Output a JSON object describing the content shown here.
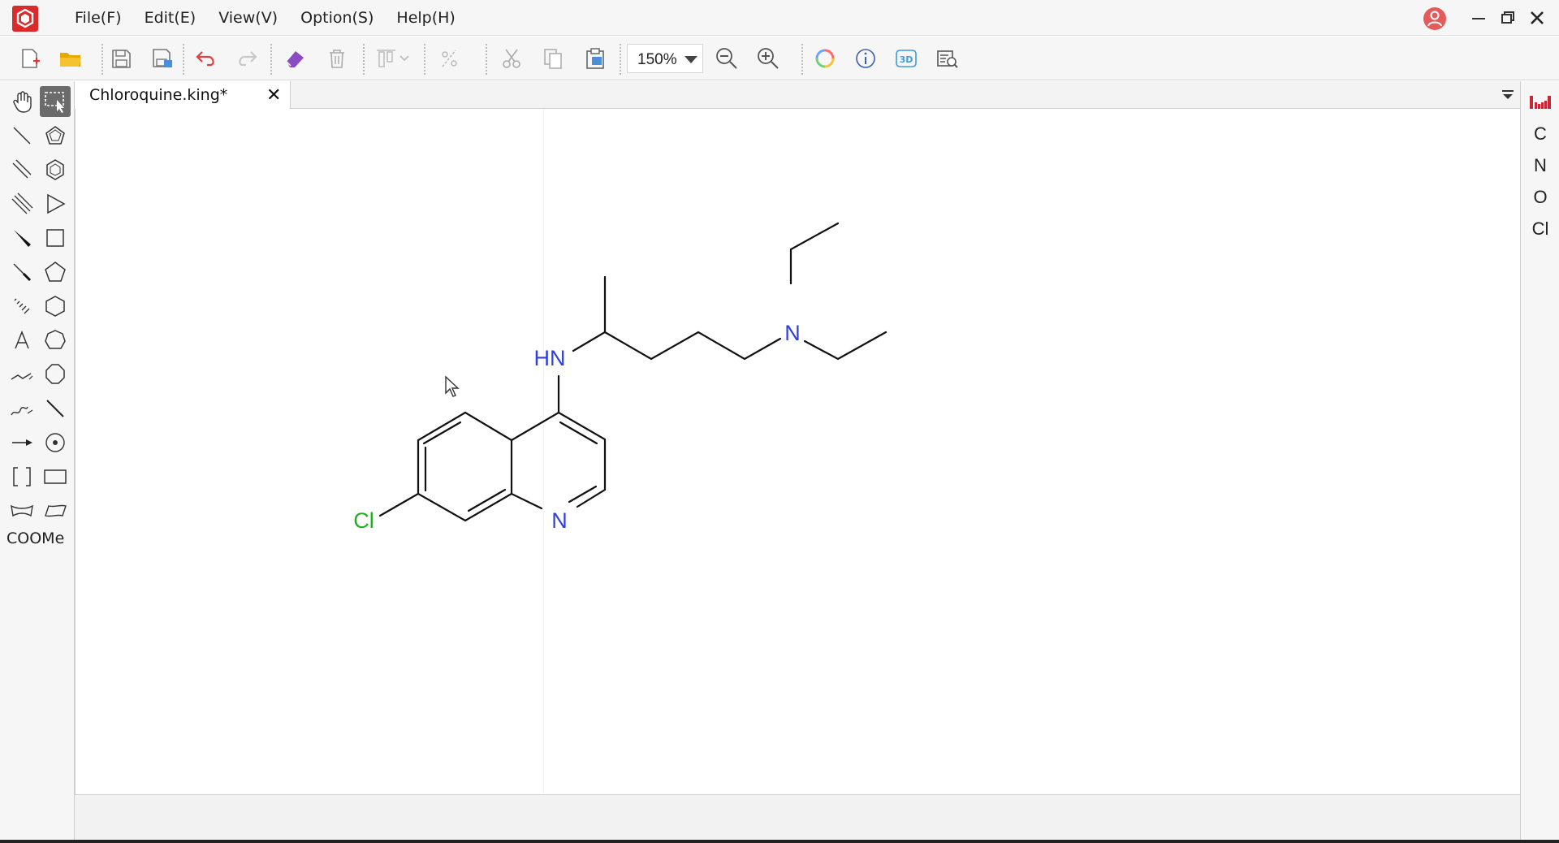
{
  "menu": {
    "file": "File(F)",
    "edit": "Edit(E)",
    "view": "View(V)",
    "option": "Option(S)",
    "help": "Help(H)"
  },
  "toolbar": {
    "zoom": "150%"
  },
  "tab": {
    "title": "Chloroquine.king*",
    "close": "✕"
  },
  "palette": {
    "coome_label": "COOMe"
  },
  "elements": [
    "C",
    "N",
    "O",
    "Cl"
  ],
  "molecule": {
    "name": "Chloroquine",
    "labels": {
      "amine": "HN",
      "tertiary_amine": "N",
      "ring_nitrogen": "N",
      "chlorine": "Cl"
    }
  },
  "colors": {
    "nitrogen": "#2f3fe0",
    "chlorine": "#22b022",
    "brand": "#d92b2b"
  }
}
